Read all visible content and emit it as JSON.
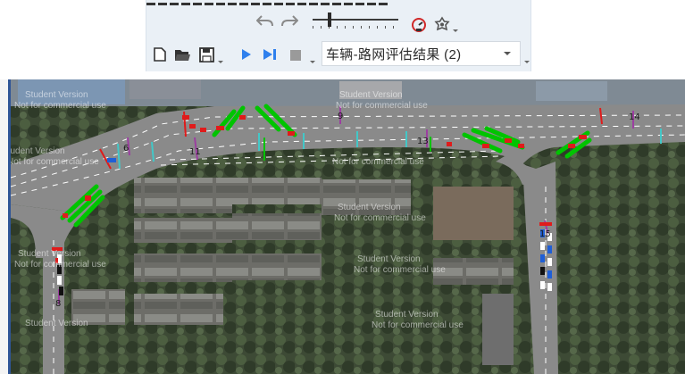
{
  "toolbar": {
    "dropdown_value": "车辆-路网评估结果 (2)",
    "icons": [
      "undo-icon",
      "redo-icon",
      "zoom-slider",
      "speedometer-icon",
      "badge-icon",
      "new-file-icon",
      "open-folder-icon",
      "save-icon",
      "play-icon",
      "step-forward-icon",
      "stop-icon"
    ],
    "zoom_level": 0.18
  },
  "map": {
    "node_labels": {
      "n6": "6",
      "n8": "8",
      "n9": "9",
      "n11": "11",
      "n13": "13",
      "n14": "14",
      "n15": "15"
    },
    "watermarks": {
      "w1a": "Student Version",
      "w1b": "Not for commercial use",
      "w2a": "Student Version",
      "w2b": "Not for commercial use",
      "w3a": "Student Version",
      "w3b": "Not for commercial use",
      "w4": "Not for commercial use",
      "w5a": "Student Version",
      "w5b": "Not for commercial use",
      "w6a": "Student Version",
      "w6b": "Not for commercial use",
      "w7a": "Student Version",
      "w7b": "Not for commercial use",
      "w8a": "Student Version",
      "w8b": "Not for commercial use",
      "w9": "Student Version"
    },
    "colors": {
      "road": "#808080",
      "lane_marking": "#ffffff",
      "evaluation_bar": "#00cc00",
      "signal_red": "#e01b1b",
      "vehicle_blue": "#1f5fd6"
    }
  }
}
